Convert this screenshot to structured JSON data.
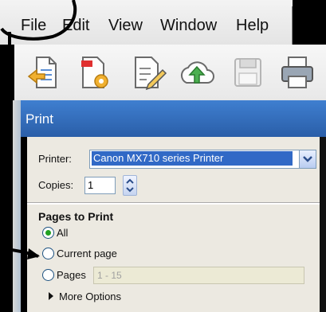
{
  "menu": [
    "File",
    "Edit",
    "View",
    "Window",
    "Help"
  ],
  "toolbar": {
    "buttons": [
      "open-document-icon",
      "settings-document-icon",
      "edit-document-icon",
      "cloud-upload-icon",
      "save-icon",
      "print-icon"
    ]
  },
  "dialog": {
    "title": "Print",
    "printer_label": "Printer:",
    "printer_value": "Canon MX710 series Printer",
    "copies_label": "Copies:",
    "copies_value": "1",
    "pages_group_title": "Pages to Print",
    "options": [
      "All",
      "Current page",
      "Pages"
    ],
    "selected_option": "All",
    "pages_range": "1 - 15",
    "more_options": "More Options"
  },
  "colors": {
    "title_bar": "#2f68b8",
    "selection": "#3169c6",
    "radio_dot": "#21a121"
  }
}
